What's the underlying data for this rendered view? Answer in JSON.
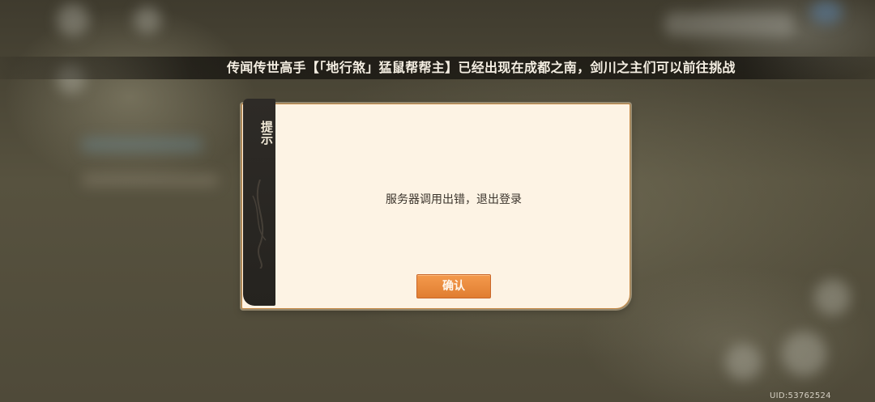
{
  "banner": {
    "text": "传闻传世高手【「地行煞」猛鼠帮帮主】已经出现在成都之南，剑川之主们可以前往挑战"
  },
  "dialog": {
    "title": "提示",
    "message": "服务器调用出错，退出登录",
    "confirm_label": "确认"
  },
  "footer": {
    "uid": "UID:53762524"
  },
  "colors": {
    "dialog_background": "#fdf3e4",
    "dialog_sidebar": "#2a2723",
    "dialog_border": "#c78a45",
    "confirm_button": "#ef8d3f"
  }
}
